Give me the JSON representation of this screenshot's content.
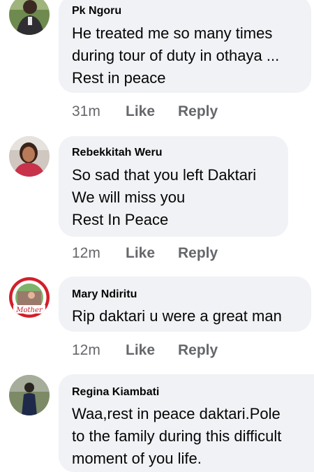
{
  "comments": [
    {
      "author": "Pk Ngoru",
      "text": "He treated me so many times\nduring tour of duty in othaya ...\nRest in peace",
      "time": "31m",
      "like_label": "Like",
      "reply_label": "Reply"
    },
    {
      "author": "Rebekkitah Weru",
      "text": "So sad that you left Daktari\nWe will miss you\nRest In Peace",
      "time": "12m",
      "like_label": "Like",
      "reply_label": "Reply"
    },
    {
      "author": "Mary Ndiritu",
      "text": "Rip daktari u were a great man",
      "time": "12m",
      "like_label": "Like",
      "reply_label": "Reply",
      "avatar_text": "Mother"
    },
    {
      "author": "Regina Kiambati",
      "text": "Waa,rest in peace daktari.Pole\nto the family during this difficult\nmoment of you life.",
      "time": "",
      "like_label": "",
      "reply_label": ""
    }
  ],
  "colors": {
    "bubble": "#f0f2f5",
    "meta": "#65676b",
    "text": "#050505"
  }
}
